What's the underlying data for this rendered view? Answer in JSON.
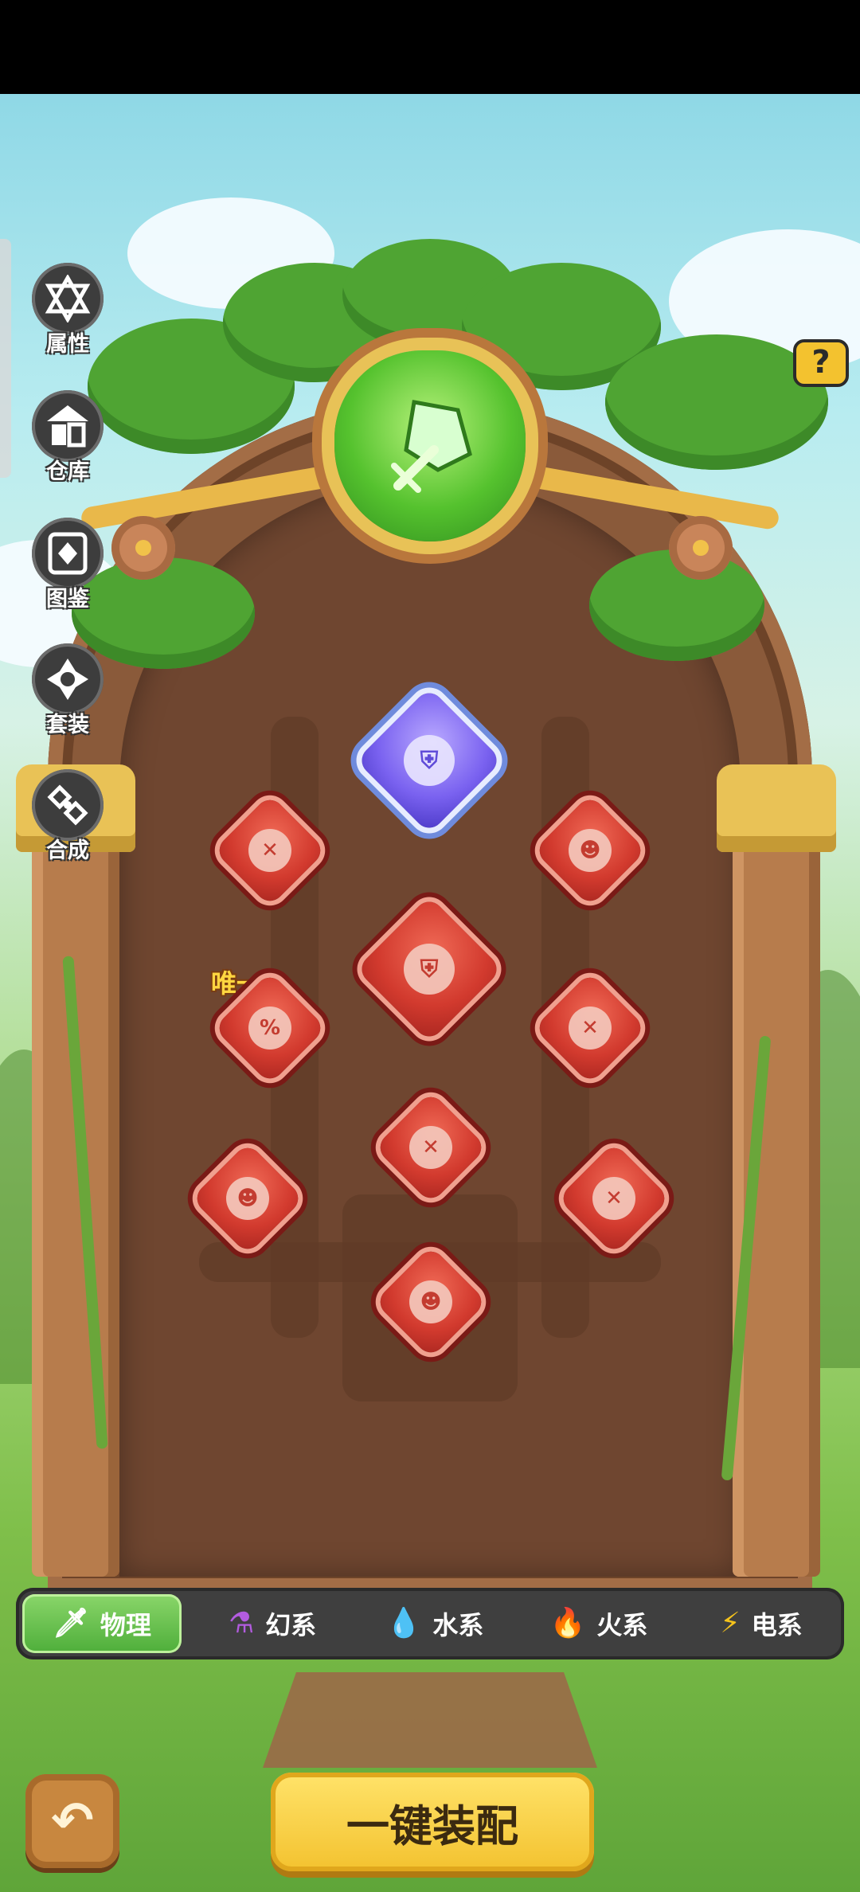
{
  "side_menu": [
    {
      "label": "属性",
      "icon": "hexagram-icon"
    },
    {
      "label": "仓库",
      "icon": "warehouse-icon"
    },
    {
      "label": "图鉴",
      "icon": "codex-icon"
    },
    {
      "label": "套装",
      "icon": "set-icon"
    },
    {
      "label": "合成",
      "icon": "synthesis-icon"
    }
  ],
  "help": {
    "label": "?"
  },
  "slots": {
    "unique_label": "唯一"
  },
  "tabs": [
    {
      "label": "物理",
      "icon": "sword-icon",
      "active": true
    },
    {
      "label": "幻系",
      "icon": "potion-icon",
      "active": false
    },
    {
      "label": "水系",
      "icon": "water-drop-icon",
      "active": false
    },
    {
      "label": "火系",
      "icon": "fire-icon",
      "active": false
    },
    {
      "label": "电系",
      "icon": "lightning-icon",
      "active": false
    }
  ],
  "bottom": {
    "back_label": "↶",
    "equip_label": "一键装配"
  },
  "colors": {
    "gem_red": "#d23a2e",
    "gem_purple": "#7a62f0",
    "emblem_green": "#55c22e",
    "tab_active": "#4eae3a",
    "equip_button": "#f3c22f"
  }
}
